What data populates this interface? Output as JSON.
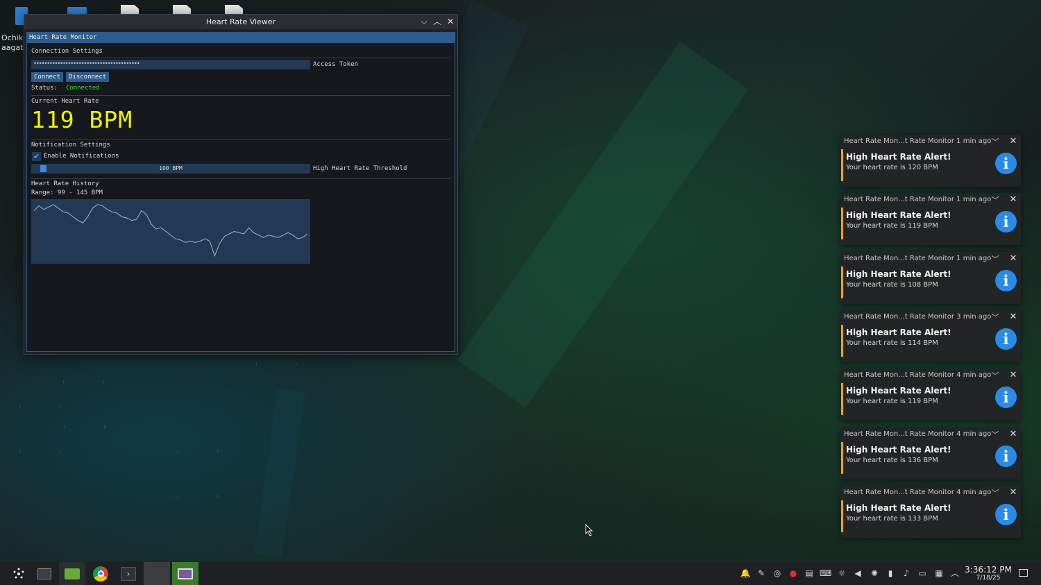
{
  "desktop": {
    "icon_label_1": "Ochik",
    "icon_label_2": "aagat"
  },
  "window": {
    "title": "Heart Rate Viewer",
    "minimize_glyph": "⌵",
    "maximize_glyph": "︿",
    "close_glyph": "✕"
  },
  "app": {
    "panel_title": "Heart Rate Monitor",
    "connection": {
      "header": "Connection Settings",
      "token_value": "••••••••••••••••••••••••••••••••••••••••",
      "token_label": "Access Token",
      "connect_label": "Connect",
      "disconnect_label": "Disconnect",
      "status_label": "Status:",
      "status_value": "Connected",
      "status_color": "#3cdc3c"
    },
    "current": {
      "header": "Current Heart Rate",
      "value": "119 BPM"
    },
    "notifications": {
      "header": "Notification Settings",
      "enable_label": "Enable Notifications",
      "enabled": true,
      "threshold_value": "100 BPM",
      "threshold_label": "High Heart Rate Threshold",
      "threshold_fraction": 0.03
    },
    "history": {
      "header": "Heart Rate History",
      "range": "Range: 99 - 145 BPM",
      "ymin": 99,
      "ymax": 145,
      "values": [
        139,
        143,
        140,
        142,
        144,
        141,
        138,
        137,
        134,
        131,
        129,
        134,
        141,
        144,
        143,
        140,
        138,
        137,
        134,
        133,
        131,
        132,
        139,
        136,
        128,
        124,
        125,
        122,
        119,
        116,
        115,
        113,
        114,
        113,
        114,
        116,
        114,
        102,
        112,
        118,
        120,
        122,
        121,
        120,
        125,
        121,
        119,
        117,
        119,
        118,
        117,
        119,
        121,
        119,
        116,
        117,
        120
      ]
    }
  },
  "notifications": [
    {
      "source": "Heart Rate Mon...t Rate Monitor",
      "time": "1 min ago",
      "title": "High Heart Rate Alert!",
      "body": "Your heart rate is 120 BPM"
    },
    {
      "source": "Heart Rate Mon...t Rate Monitor",
      "time": "1 min ago",
      "title": "High Heart Rate Alert!",
      "body": "Your heart rate is 119 BPM"
    },
    {
      "source": "Heart Rate Mon...t Rate Monitor",
      "time": "1 min ago",
      "title": "High Heart Rate Alert!",
      "body": "Your heart rate is 108 BPM"
    },
    {
      "source": "Heart Rate Mon...t Rate Monitor",
      "time": "3 min ago",
      "title": "High Heart Rate Alert!",
      "body": "Your heart rate is 114 BPM"
    },
    {
      "source": "Heart Rate Mon...t Rate Monitor",
      "time": "4 min ago",
      "title": "High Heart Rate Alert!",
      "body": "Your heart rate is 119 BPM"
    },
    {
      "source": "Heart Rate Mon...t Rate Monitor",
      "time": "4 min ago",
      "title": "High Heart Rate Alert!",
      "body": "Your heart rate is 136 BPM"
    },
    {
      "source": "Heart Rate Mon...t Rate Monitor",
      "time": "4 min ago",
      "title": "High Heart Rate Alert!",
      "body": "Your heart rate is 133 BPM"
    }
  ],
  "taskbar": {
    "clock_time": "3:36:12 PM",
    "clock_date": "7/18/25",
    "icons": [
      "launcher-icon",
      "system-settings-icon",
      "file-manager-icon",
      "chrome-icon",
      "terminal-icon",
      "blank-window-icon",
      "heart-rate-viewer-icon"
    ],
    "tray_icons": [
      "notification-bell-icon",
      "mute-mic-icon",
      "steam-icon",
      "record-icon",
      "clipboard-icon",
      "keyboard-icon",
      "brightness-icon",
      "volume-icon",
      "night-color-icon",
      "usb-icon",
      "microphone-icon",
      "display-icon",
      "network-icon",
      "tray-expand-icon"
    ],
    "accent_color": "#2a8be6"
  }
}
